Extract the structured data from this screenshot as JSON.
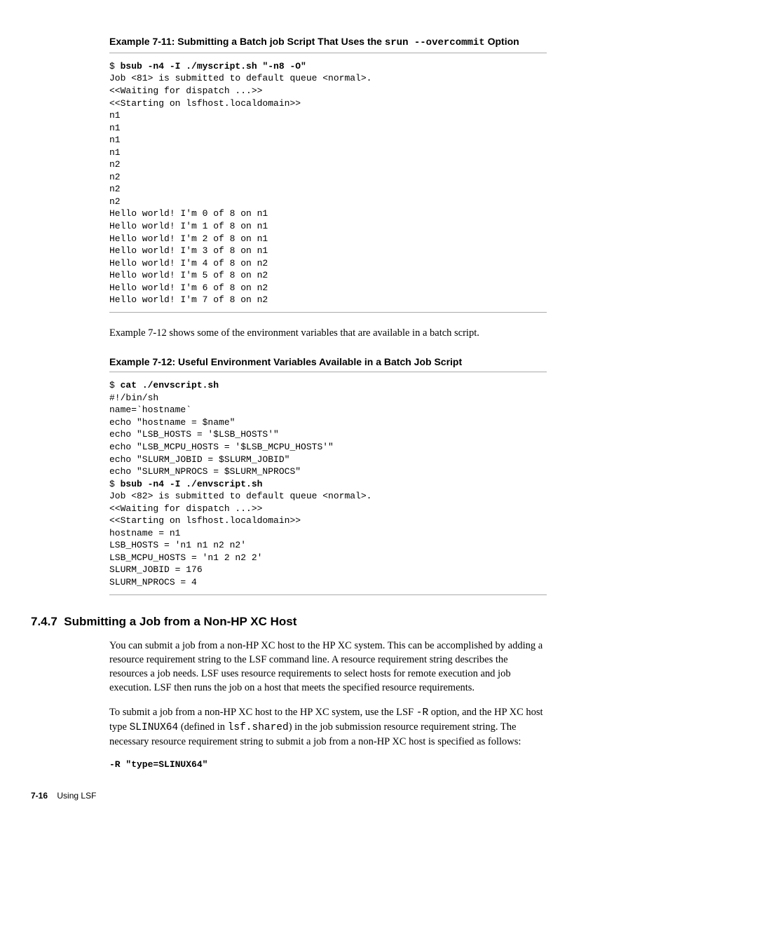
{
  "example711": {
    "title_prefix": "Example 7-11: Submitting a Batch job Script That Uses the ",
    "title_mono": "srun --overcommit",
    "title_suffix": " Option",
    "cmd_prompt": "$ ",
    "cmd": "bsub -n4 -I ./myscript.sh \"-n8 -O\"",
    "output": "Job <81> is submitted to default queue <normal>.\n<<Waiting for dispatch ...>>\n<<Starting on lsfhost.localdomain>>\nn1\nn1\nn1\nn1\nn2\nn2\nn2\nn2\nHello world! I'm 0 of 8 on n1\nHello world! I'm 1 of 8 on n1\nHello world! I'm 2 of 8 on n1\nHello world! I'm 3 of 8 on n1\nHello world! I'm 4 of 8 on n2\nHello world! I'm 5 of 8 on n2\nHello world! I'm 6 of 8 on n2\nHello world! I'm 7 of 8 on n2"
  },
  "intertext": "Example 7-12 shows some of the environment variables that are available in a batch script.",
  "example712": {
    "title": "Example 7-12: Useful Environment Variables Available in a Batch Job Script",
    "cmd1_prompt": "$ ",
    "cmd1": "cat ./envscript.sh",
    "out1": "#!/bin/sh\nname=`hostname`\necho \"hostname = $name\"\necho \"LSB_HOSTS = '$LSB_HOSTS'\"\necho \"LSB_MCPU_HOSTS = '$LSB_MCPU_HOSTS'\"\necho \"SLURM_JOBID = $SLURM_JOBID\"\necho \"SLURM_NPROCS = $SLURM_NPROCS\"",
    "cmd2_prompt": "$ ",
    "cmd2": "bsub -n4 -I ./envscript.sh",
    "out2": "Job <82> is submitted to default queue <normal>.\n<<Waiting for dispatch ...>>\n<<Starting on lsfhost.localdomain>>\nhostname = n1\nLSB_HOSTS = 'n1 n1 n2 n2'\nLSB_MCPU_HOSTS = 'n1 2 n2 2'\nSLURM_JOBID = 176\nSLURM_NPROCS = 4"
  },
  "section": {
    "number": "7.4.7",
    "title": "Submitting a Job from a Non-HP XC Host",
    "para1": "You can submit a job from a non-HP XC host to the HP XC system. This can be accomplished by adding a resource requirement string to the LSF command line. A resource requirement string describes the resources a job needs. LSF uses resource requirements to select hosts for remote execution and job execution. LSF then runs the job on a host that meets the specified resource requirements.",
    "para2_a": "To submit a job from a non-HP XC host to the HP XC system, use the LSF ",
    "para2_m1": "-R",
    "para2_b": " option, and the HP XC host type ",
    "para2_m2": "SLINUX64",
    "para2_c": " (defined in ",
    "para2_m3": "lsf.shared",
    "para2_d": ") in the job submission resource requirement string. The necessary resource requirement string to submit a job from a non-HP XC host is specified as follows:",
    "cmd": "-R \"type=SLINUX64\""
  },
  "footer": {
    "page": "7-16",
    "label": "Using LSF"
  }
}
